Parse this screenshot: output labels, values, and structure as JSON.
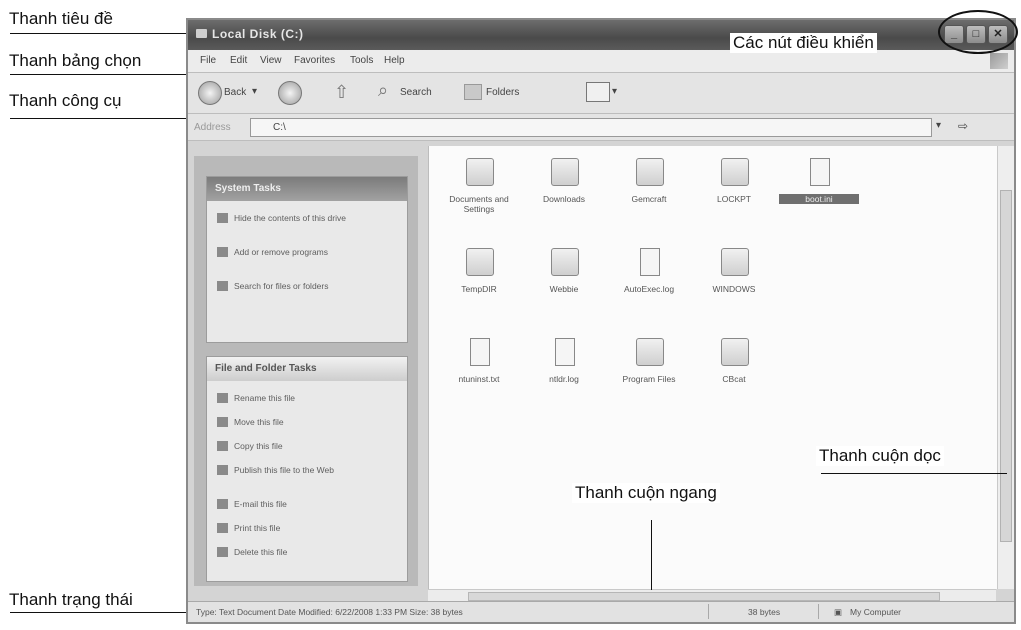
{
  "callouts": {
    "title_bar": "Thanh tiêu đề",
    "menu_bar": "Thanh bảng chọn",
    "toolbar": "Thanh công cụ",
    "control_buttons": "Các nút điều khiển",
    "vertical_scrollbar": "Thanh cuộn dọc",
    "horizontal_scrollbar": "Thanh cuộn ngang",
    "status_bar": "Thanh trạng thái"
  },
  "window": {
    "title": "Local Disk (C:)",
    "menu": [
      "File",
      "Edit",
      "View",
      "Favorites",
      "Tools",
      "Help"
    ],
    "toolbar": {
      "back": "Back",
      "search": "Search",
      "folders": "Folders"
    },
    "address_label": "Address",
    "address_value": "C:\\",
    "system_tasks": {
      "title": "System Tasks",
      "items": [
        "Hide the contents of this drive",
        "Add or remove programs",
        "Search for files or folders"
      ]
    },
    "file_tasks": {
      "title": "File and Folder Tasks",
      "items": [
        "Rename this file",
        "Move this file",
        "Copy this file",
        "Publish this file to the Web",
        "E-mail this file",
        "Print this file",
        "Delete this file"
      ]
    },
    "files": [
      {
        "name": "Documents and Settings",
        "kind": "folder"
      },
      {
        "name": "Downloads",
        "kind": "folder"
      },
      {
        "name": "Gemcraft",
        "kind": "folder"
      },
      {
        "name": "LOCKPT",
        "kind": "folder"
      },
      {
        "name": "boot.ini",
        "kind": "doc"
      },
      {
        "name": "TempDIR",
        "kind": "folder"
      },
      {
        "name": "Webbie",
        "kind": "folder"
      },
      {
        "name": "AutoExec.log",
        "kind": "doc"
      },
      {
        "name": "WINDOWS",
        "kind": "folder"
      },
      {
        "name": "ntuninst.txt",
        "kind": "doc"
      },
      {
        "name": "ntldr.log",
        "kind": "doc"
      },
      {
        "name": "Program Files",
        "kind": "folder"
      },
      {
        "name": "CBcat",
        "kind": "folder"
      }
    ],
    "status": {
      "info": "Type: Text Document Date Modified: 6/22/2008 1:33 PM Size: 38 bytes",
      "size": "38 bytes",
      "location": "My Computer"
    }
  }
}
